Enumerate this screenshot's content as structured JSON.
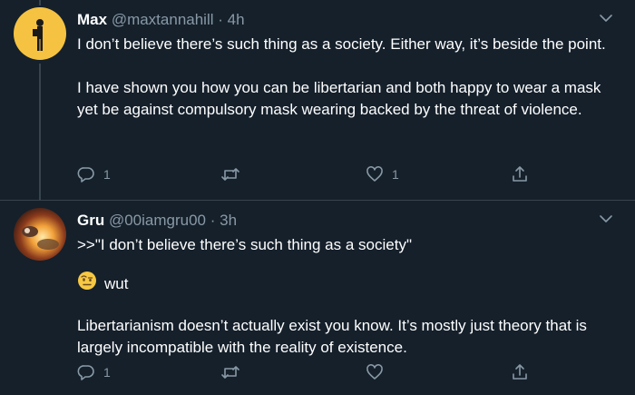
{
  "tweets": [
    {
      "name": "Max",
      "handle": "@maxtannahill",
      "dot": "·",
      "time": "4h",
      "paragraphs": [
        "I don’t believe there’s such thing as a society. Either way, it’s beside the point.",
        "I have shown you how you can be libertarian and both happy to wear a mask yet be against compulsory mask wearing backed by the threat of violence."
      ],
      "reply_count": "1",
      "retweet_count": "",
      "like_count": "1"
    },
    {
      "name": "Gru",
      "handle": "@00iamgru00",
      "dot": "·",
      "time": "3h",
      "quote": ">>\"I don’t believe there’s such thing as a society\"",
      "emoji_text": "wut",
      "paragraph": "Libertarianism doesn’t actually exist you know. It’s mostly just theory that is largely incompatible with the reality of existence.",
      "reply_count": "1",
      "retweet_count": "",
      "like_count": ""
    }
  ],
  "colors": {
    "background": "#15202b",
    "secondary_text": "#8899a6",
    "divider": "#38444d",
    "avatar_max_bg": "#f5c242"
  },
  "icons": [
    "reply-icon",
    "retweet-icon",
    "like-icon",
    "share-icon",
    "chevron-down-icon",
    "raised-eyebrow-emoji"
  ]
}
